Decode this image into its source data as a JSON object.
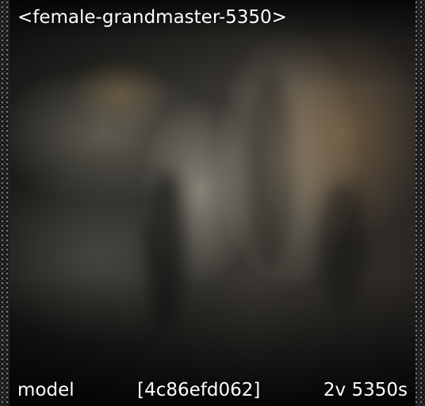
{
  "header": {
    "title": "<female-grandmaster-5350>"
  },
  "footer": {
    "left": "model",
    "center": "[4c86efd062]",
    "right": "2v 5350s"
  },
  "image": {
    "subject": "sandstone-rock-formation",
    "palette": {
      "light": "#b9b4a6",
      "mid": "#6f6b61",
      "dark": "#1a1a18",
      "warm": "#9a7a4e",
      "border_dots": "#6a6a6a"
    }
  }
}
